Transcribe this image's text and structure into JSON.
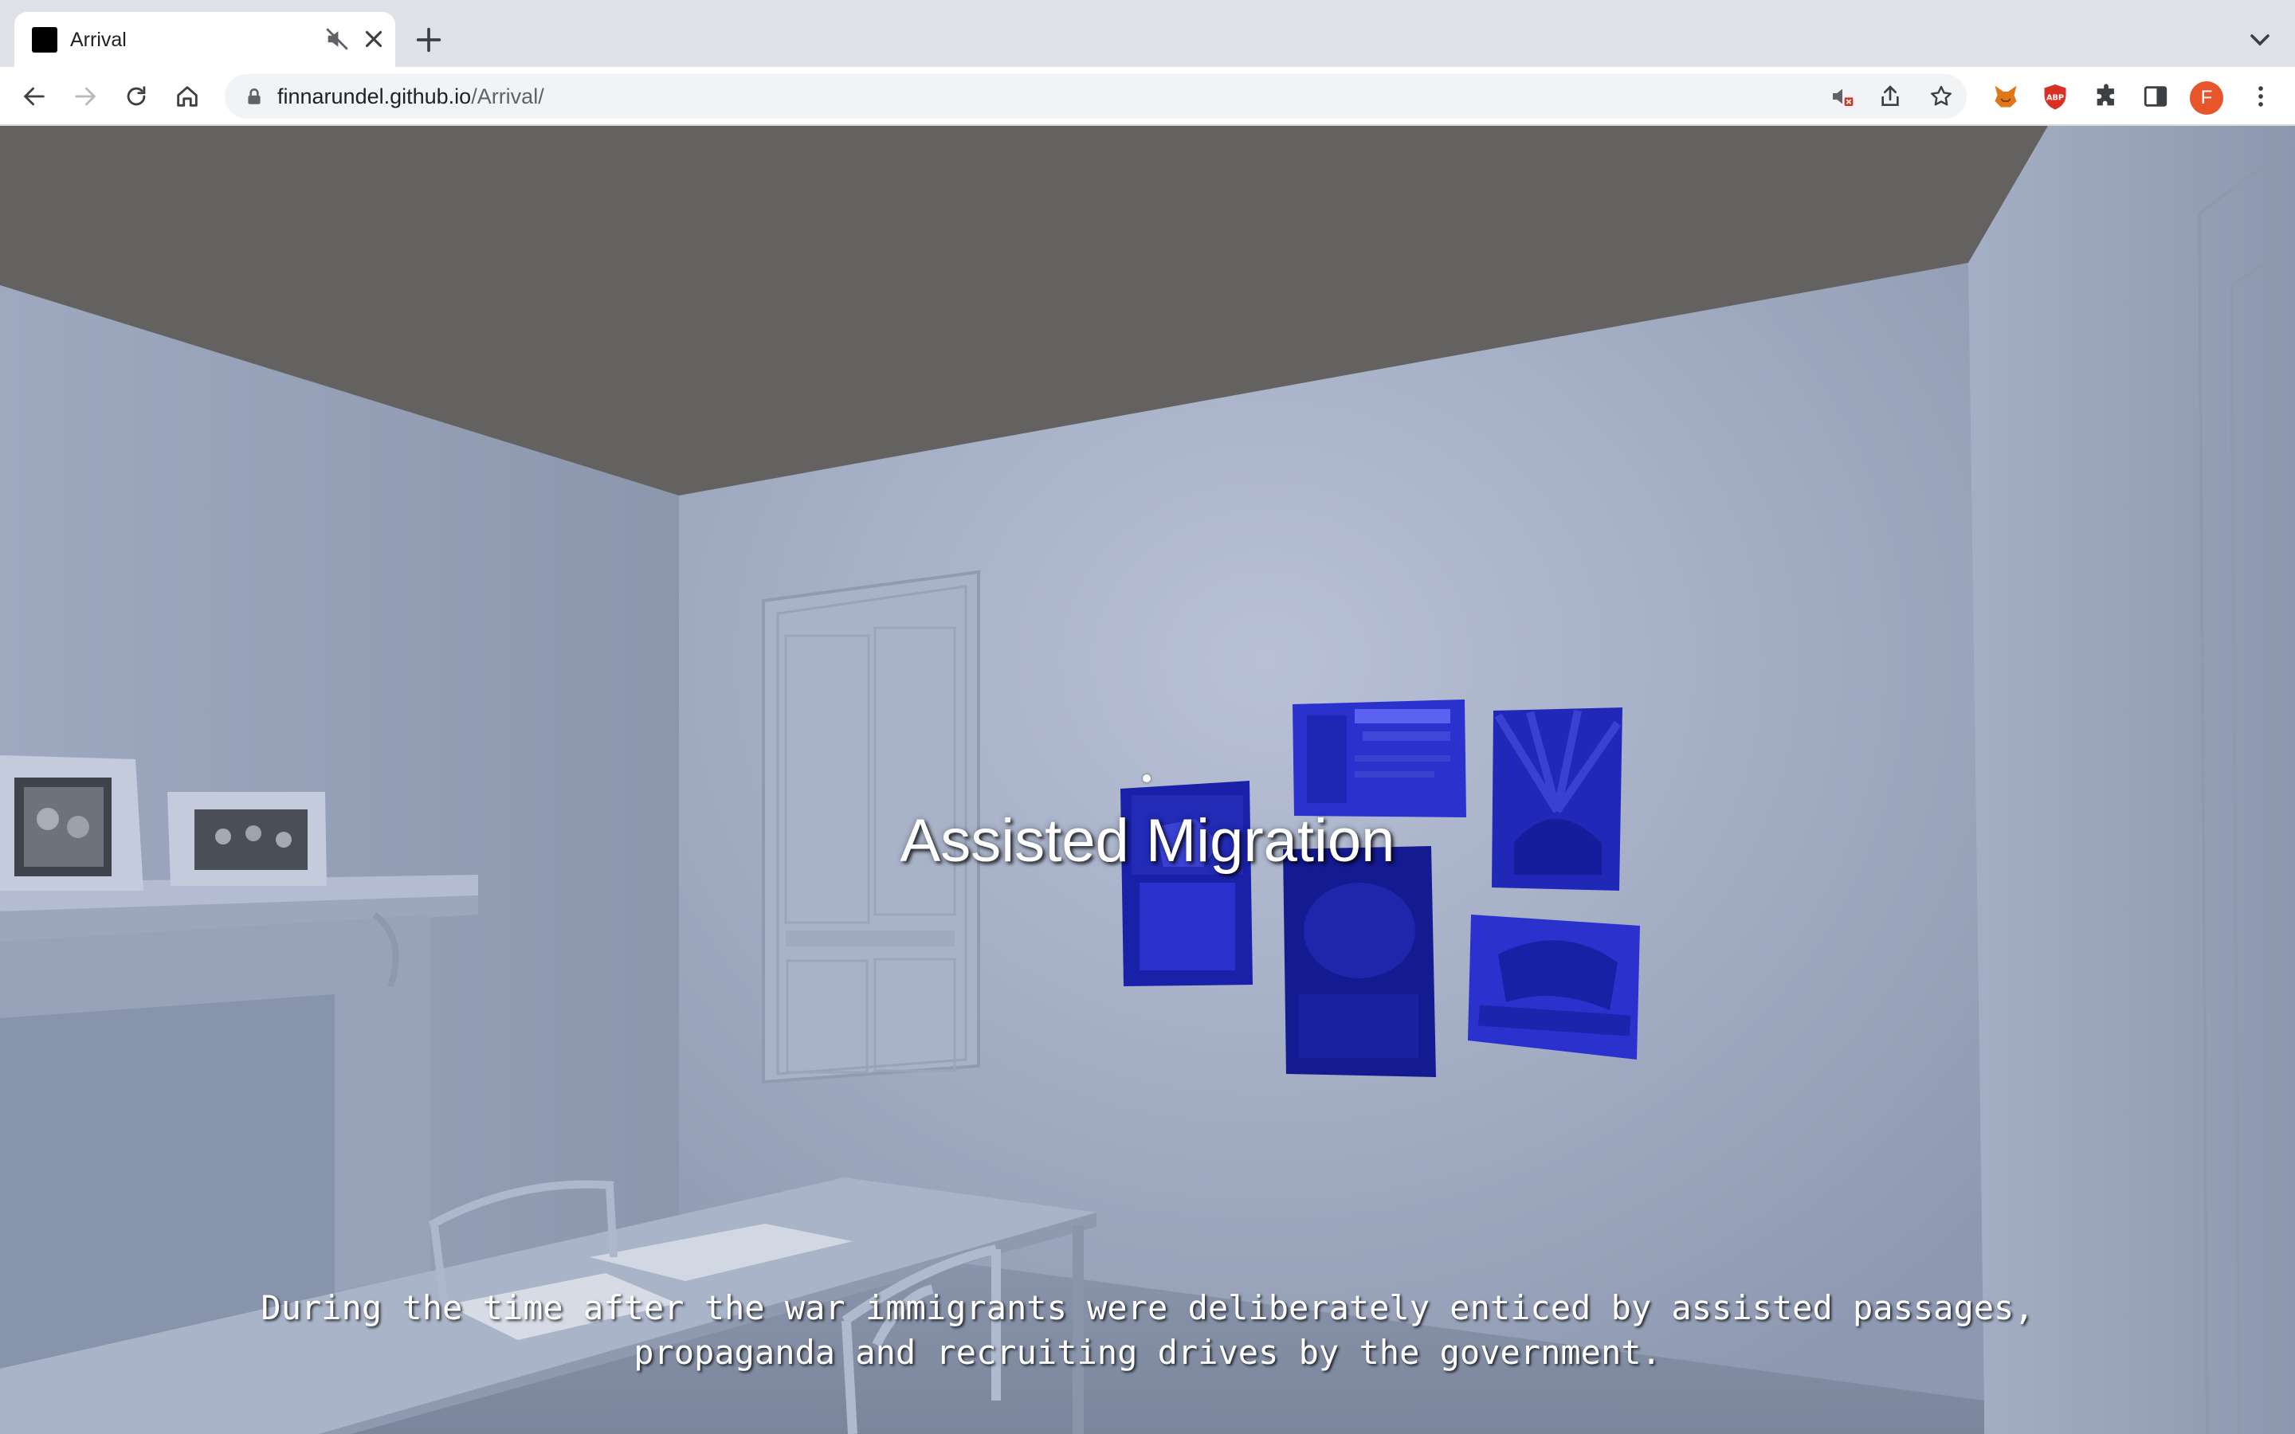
{
  "browser": {
    "tab": {
      "title": "Arrival"
    },
    "url": {
      "host": "finnarundel.github.io",
      "path": "/Arrival/"
    },
    "profile_initial": "F"
  },
  "scene": {
    "title": "Assisted Migration",
    "subtitle_line1": "During the time after the war immigrants were deliberately enticed by assisted passages,",
    "subtitle_line2": "propaganda and recruiting drives by the government.",
    "posters": [
      {
        "name": "poster-australia-map"
      },
      {
        "name": "poster-earn-a-week"
      },
      {
        "name": "poster-sun-rays"
      },
      {
        "name": "poster-dark-center"
      },
      {
        "name": "poster-bring-out-a-briton"
      }
    ]
  },
  "colors": {
    "ceiling": "#636260",
    "wall": "#a7b1c8",
    "poster": "#2a31cc",
    "accent_avatar": "#e8552c"
  }
}
